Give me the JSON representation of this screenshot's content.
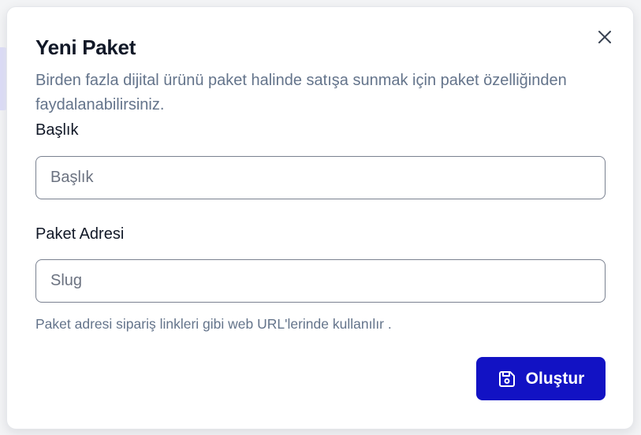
{
  "modal": {
    "title": "Yeni Paket",
    "description": "Birden fazla dijital ürünü paket halinde satışa sunmak için paket özelliğinden faydalanabilirsiniz.",
    "close_icon": "close-icon"
  },
  "form": {
    "title_field": {
      "label": "Başlık",
      "placeholder": "Başlık",
      "value": ""
    },
    "slug_field": {
      "label": "Paket Adresi",
      "placeholder": "Slug",
      "value": "",
      "hint": "Paket adresi sipariş linkleri gibi web URL'lerinde kullanılır ."
    },
    "submit": {
      "label": "Oluştur",
      "icon": "save-icon"
    }
  },
  "colors": {
    "primary": "#1212c4",
    "text_primary": "#111827",
    "text_muted": "#64748b",
    "input_border": "#7a8190"
  }
}
